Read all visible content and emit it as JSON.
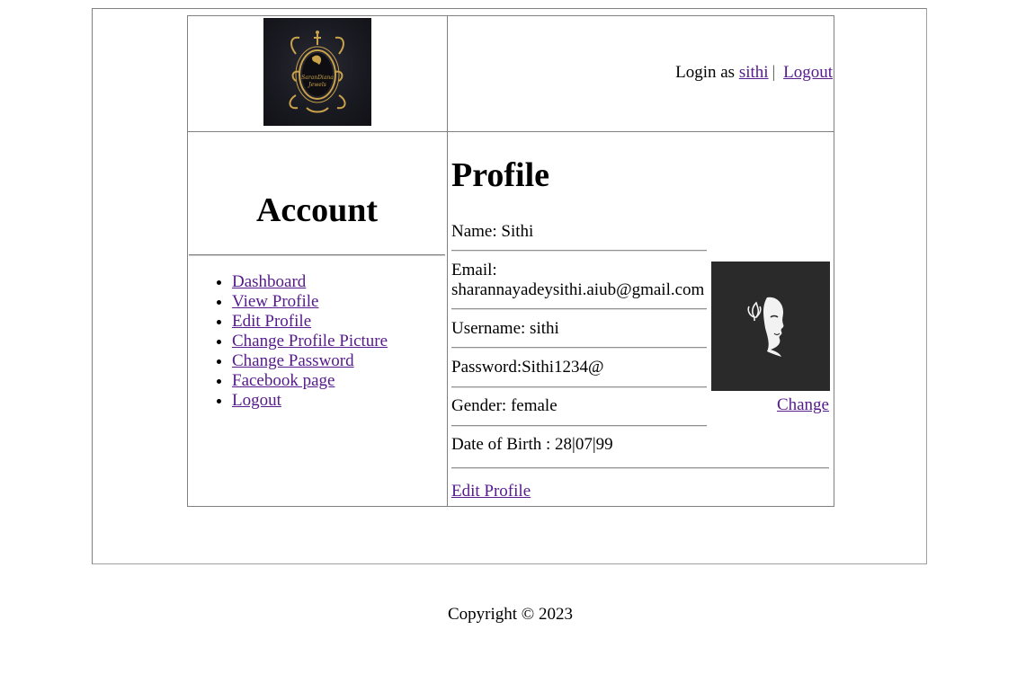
{
  "header": {
    "login_prefix": "Login as",
    "username_link": "sithi",
    "separator": "|",
    "logout_link": "Logout"
  },
  "sidebar": {
    "title": "Account",
    "items": [
      {
        "label": "Dashboard"
      },
      {
        "label": "View Profile"
      },
      {
        "label": "Edit Profile"
      },
      {
        "label": "Change Profile Picture"
      },
      {
        "label": "Change Password"
      },
      {
        "label": "Facebook page"
      },
      {
        "label": "Logout"
      }
    ]
  },
  "profile": {
    "title": "Profile",
    "name": "Name: Sithi",
    "email_label": "Email:",
    "email_value": "sharannayadeysithi.aiub@gmail.com",
    "username": "Username: sithi",
    "password": "Password:Sithi1234@",
    "gender": "Gender: female",
    "dob": "Date of Birth : 28|07|99",
    "change_link": "Change",
    "edit_link": "Edit Profile"
  },
  "footer": {
    "copyright": "Copyright © 2023"
  }
}
